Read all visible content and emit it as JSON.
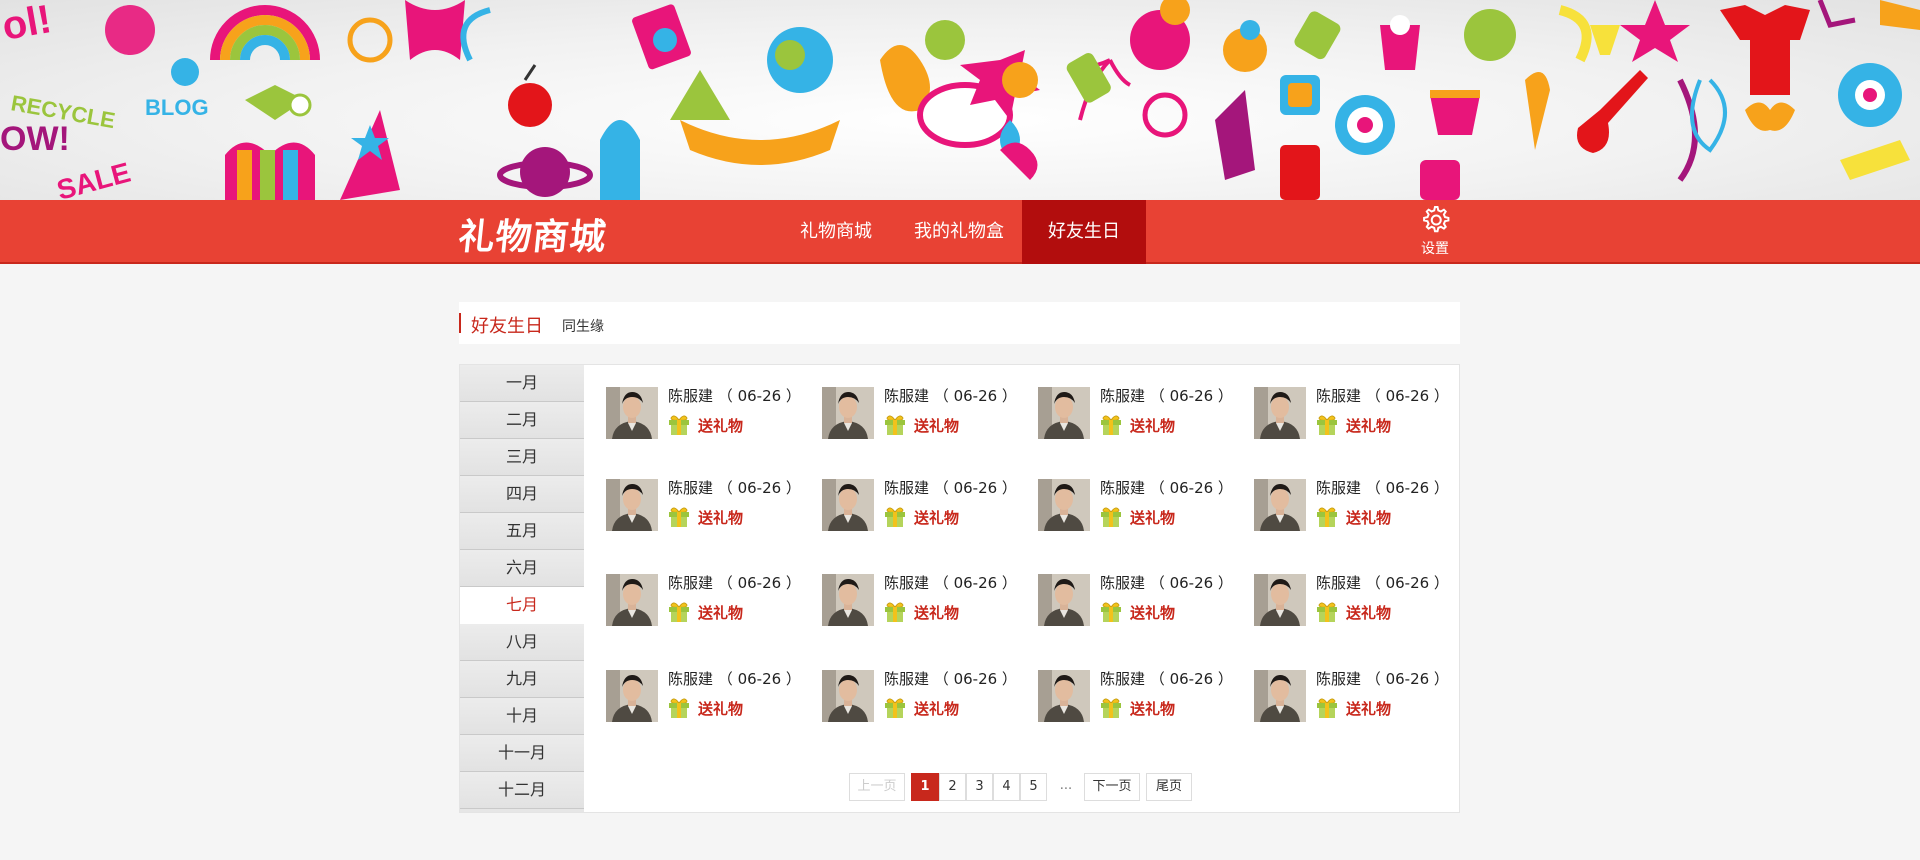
{
  "header": {
    "logo": "礼物商城",
    "nav": [
      {
        "label": "礼物商城"
      },
      {
        "label": "我的礼物盒"
      },
      {
        "label": "好友生日",
        "active": true
      }
    ],
    "settings_label": "设置"
  },
  "subheader": {
    "title": "好友生日",
    "subtitle": "同生缘"
  },
  "months": [
    "一月",
    "二月",
    "三月",
    "四月",
    "五月",
    "六月",
    "七月",
    "八月",
    "九月",
    "十月",
    "十一月",
    "十二月"
  ],
  "active_month": "七月",
  "friends": [
    {
      "name": "陈服建",
      "date": "（ 06-26 ）",
      "action": "送礼物"
    },
    {
      "name": "陈服建",
      "date": "（ 06-26 ）",
      "action": "送礼物"
    },
    {
      "name": "陈服建",
      "date": "（ 06-26 ）",
      "action": "送礼物"
    },
    {
      "name": "陈服建",
      "date": "（ 06-26 ）",
      "action": "送礼物"
    },
    {
      "name": "陈服建",
      "date": "（ 06-26 ）",
      "action": "送礼物"
    },
    {
      "name": "陈服建",
      "date": "（ 06-26 ）",
      "action": "送礼物"
    },
    {
      "name": "陈服建",
      "date": "（ 06-26 ）",
      "action": "送礼物"
    },
    {
      "name": "陈服建",
      "date": "（ 06-26 ）",
      "action": "送礼物"
    },
    {
      "name": "陈服建",
      "date": "（ 06-26 ）",
      "action": "送礼物"
    },
    {
      "name": "陈服建",
      "date": "（ 06-26 ）",
      "action": "送礼物"
    },
    {
      "name": "陈服建",
      "date": "（ 06-26 ）",
      "action": "送礼物"
    },
    {
      "name": "陈服建",
      "date": "（ 06-26 ）",
      "action": "送礼物"
    },
    {
      "name": "陈服建",
      "date": "（ 06-26 ）",
      "action": "送礼物"
    },
    {
      "name": "陈服建",
      "date": "（ 06-26 ）",
      "action": "送礼物"
    },
    {
      "name": "陈服建",
      "date": "（ 06-26 ）",
      "action": "送礼物"
    },
    {
      "name": "陈服建",
      "date": "（ 06-26 ）",
      "action": "送礼物"
    }
  ],
  "pagination": {
    "prev": "上一页",
    "pages": [
      "1",
      "2",
      "3",
      "4",
      "5"
    ],
    "current": "1",
    "ellipsis": "...",
    "next": "下一页",
    "last": "尾页"
  },
  "colors": {
    "brand_red": "#e84234",
    "active_red": "#b20d0d",
    "accent_text": "#c8281c"
  },
  "icons": {
    "settings": "gear-icon",
    "gift": "gift-icon"
  }
}
